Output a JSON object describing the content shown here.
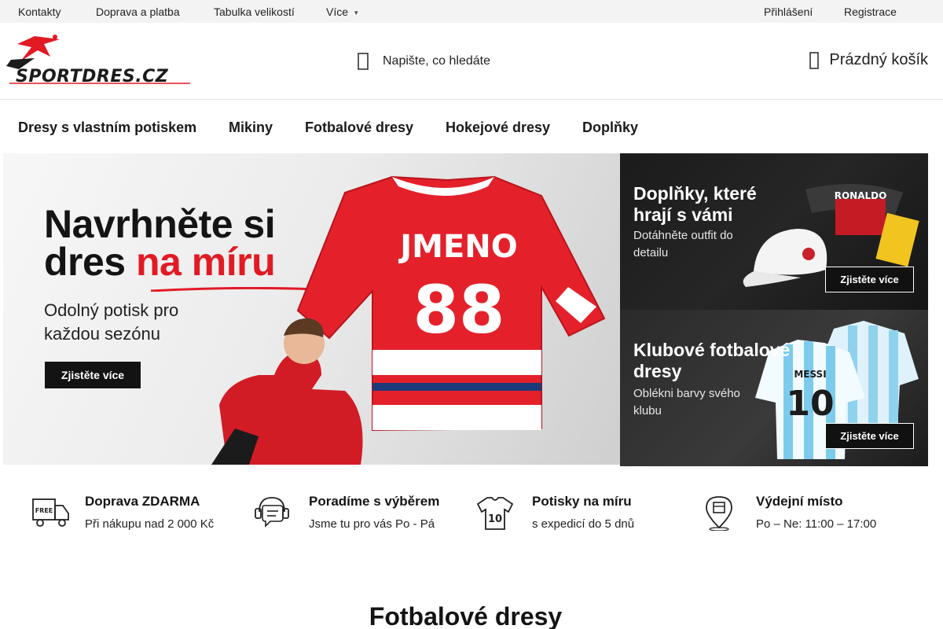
{
  "topbar": {
    "links": [
      "Kontakty",
      "Doprava a platba",
      "Tabulka velikostí",
      "Více"
    ],
    "login": "Přihlášení",
    "register": "Registrace"
  },
  "header": {
    "logo_text": "SPORTDRES.CZ",
    "search_placeholder": "Napište, co hledáte",
    "cart_label": "Prázdný košík"
  },
  "categories": [
    "Dresy s vlastním potiskem",
    "Mikiny",
    "Fotbalové dresy",
    "Hokejové dresy",
    "Doplňky"
  ],
  "banners": {
    "main": {
      "title_line1": "Navrhněte si",
      "title_line2_black": "dres ",
      "title_line2_red": "na míru",
      "subtitle_line1": "Odolný potisk pro",
      "subtitle_line2": "každou sezónu",
      "cta": "Zjistěte více",
      "jersey_name": "JMENO",
      "jersey_number": "88"
    },
    "side_top": {
      "title": "Doplňky, které hrají s vámi",
      "subtitle": "Dotáhněte outfit do detailu",
      "cta": "Zjistěte více",
      "product_text": "RONALDO"
    },
    "side_bottom": {
      "title": "Klubové fotbalové dresy",
      "subtitle": "Oblékni barvy svého klubu",
      "cta": "Zjistěte více",
      "jersey_name": "MESSI",
      "jersey_number": "10"
    }
  },
  "benefits": [
    {
      "icon": "truck-free-icon",
      "icon_text": "FREE",
      "title": "Doprava ZDARMA",
      "text": "Při nákupu nad 2 000 Kč"
    },
    {
      "icon": "support-chat-icon",
      "title": "Poradíme s výběrem",
      "text": "Jsme tu pro vás Po - Pá"
    },
    {
      "icon": "jersey-print-icon",
      "icon_text": "10",
      "title": "Potisky na míru",
      "text": "s expedicí do 5 dnů"
    },
    {
      "icon": "pickup-location-icon",
      "title": "Výdejní místo",
      "text": "Po – Ne: 11:00 – 17:00"
    }
  ],
  "section_title": "Fotbalové dresy",
  "colors": {
    "accent_red": "#e21a24",
    "topbar_bg": "#f3f3f3",
    "text_dark": "#141414"
  }
}
